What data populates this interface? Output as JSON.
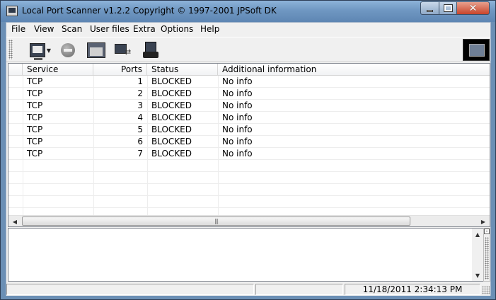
{
  "window": {
    "title": "Local Port Scanner v1.2.2 Copyright © 1997-2001 JPSoft DK"
  },
  "menu": [
    "File",
    "View",
    "Scan",
    "User files",
    "Extra",
    "Options",
    "Help"
  ],
  "toolbar": {
    "icons": [
      "scan-computer-icon",
      "stop-icon",
      "user-files-icon",
      "connections-icon",
      "tools-icon"
    ]
  },
  "list": {
    "columns": [
      "Service",
      "Ports",
      "Status",
      "Additional information"
    ],
    "rows": [
      {
        "service": "TCP",
        "port": "1",
        "status": "BLOCKED",
        "info": "No info"
      },
      {
        "service": "TCP",
        "port": "2",
        "status": "BLOCKED",
        "info": "No info"
      },
      {
        "service": "TCP",
        "port": "3",
        "status": "BLOCKED",
        "info": "No info"
      },
      {
        "service": "TCP",
        "port": "4",
        "status": "BLOCKED",
        "info": "No info"
      },
      {
        "service": "TCP",
        "port": "5",
        "status": "BLOCKED",
        "info": "No info"
      },
      {
        "service": "TCP",
        "port": "6",
        "status": "BLOCKED",
        "info": "No info"
      },
      {
        "service": "TCP",
        "port": "7",
        "status": "BLOCKED",
        "info": "No info"
      }
    ]
  },
  "log": {
    "text": ""
  },
  "statusbar": {
    "panel1": "",
    "panel2": "",
    "datetime": "11/18/2011 2:34:13 PM"
  },
  "colors": {
    "titlebar": "#6f97c2",
    "close_button": "#c8452b",
    "client_background": "#f0f0f0"
  }
}
